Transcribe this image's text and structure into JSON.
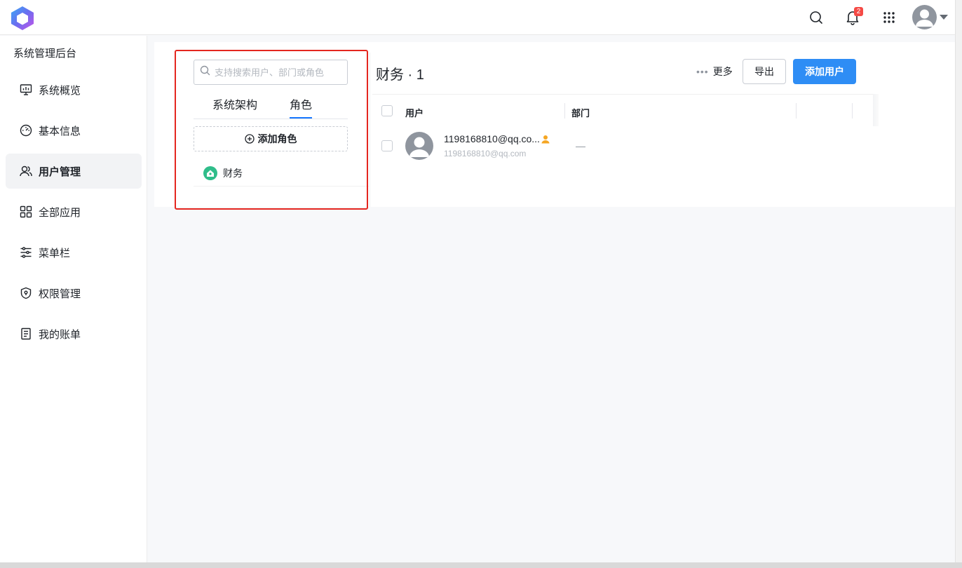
{
  "header": {
    "notification_count": "2"
  },
  "sidebar": {
    "title": "系统管理后台",
    "items": [
      {
        "label": "系统概览",
        "icon": "monitor-icon"
      },
      {
        "label": "基本信息",
        "icon": "dashboard-icon"
      },
      {
        "label": "用户管理",
        "icon": "users-icon",
        "active": true
      },
      {
        "label": "全部应用",
        "icon": "grid-icon"
      },
      {
        "label": "菜单栏",
        "icon": "sliders-icon"
      },
      {
        "label": "权限管理",
        "icon": "shield-icon"
      },
      {
        "label": "我的账单",
        "icon": "receipt-icon"
      }
    ]
  },
  "role_panel": {
    "search_placeholder": "支持搜索用户、部门或角色",
    "tabs": [
      "系统架构",
      "角色"
    ],
    "active_tab": "角色",
    "add_role_label": "添加角色",
    "roles": [
      {
        "name": "财务"
      }
    ]
  },
  "content": {
    "heading": "财务 · 1",
    "more_label": "更多",
    "export_label": "导出",
    "add_user_label": "添加用户",
    "columns": [
      "用户",
      "部门"
    ],
    "rows": [
      {
        "name": "1198168810@qq.co...",
        "email": "1198168810@qq.com",
        "department": "—"
      }
    ]
  },
  "colors": {
    "primary": "#2e8df5",
    "tab_active": "#1677ff",
    "highlight": "#e4261f",
    "role_icon": "#2fbd8a",
    "badge": "#f54a45"
  }
}
